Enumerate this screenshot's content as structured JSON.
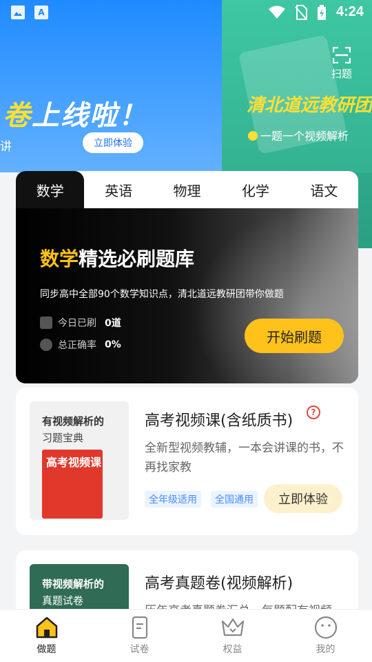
{
  "status_bar": {
    "time": "4:24",
    "icon_a": "A"
  },
  "banner": {
    "left_headline_yellow": "卷",
    "left_headline_white": "上线啦！",
    "left_sub": "讲",
    "left_button": "立即体验",
    "right_title": "清北道远教研团",
    "right_sub": "一题一个视频解析",
    "scan_label": "扫题"
  },
  "subject_tabs": [
    {
      "label": "数学",
      "active": true
    },
    {
      "label": "英语",
      "active": false
    },
    {
      "label": "物理",
      "active": false
    },
    {
      "label": "化学",
      "active": false
    },
    {
      "label": "语文",
      "active": false
    }
  ],
  "subject_panel": {
    "title_highlight": "数学",
    "title_rest": "精选必刷题库",
    "description": "同步高中全部90个数学知识点，清北道远教研团带你做题",
    "today_label": "今日已刷",
    "today_value": "0道",
    "accuracy_label": "总正确率",
    "accuracy_value": "0%",
    "start_button": "开始刷题"
  },
  "products": [
    {
      "cover_line1": "有视频解析的",
      "cover_line2": "习题宝典",
      "cover_book_title": "高考视频课",
      "title": "高考视频课(含纸质书)",
      "description": "全新型视频教辅，一本会讲课的书，不再找家教",
      "tags": [
        "全年级适用",
        "全国通用"
      ],
      "button": "立即体验"
    },
    {
      "cover_line1": "带视频解析的",
      "cover_line2": "真题试卷",
      "title": "高考真题卷(视频解析)",
      "description": "历年高考真题卷汇总，每题配有视频"
    }
  ],
  "bottom_nav": [
    {
      "label": "做题",
      "icon": "home-icon",
      "active": true
    },
    {
      "label": "试卷",
      "icon": "paper-icon",
      "active": false
    },
    {
      "label": "权益",
      "icon": "crown-icon",
      "active": false
    },
    {
      "label": "我的",
      "icon": "profile-icon",
      "active": false
    }
  ],
  "colors": {
    "banner_blue": "#1f8bff",
    "banner_green": "#3ec7a2",
    "accent_yellow": "#ffc21a",
    "tag_blue": "#4a8dff"
  }
}
